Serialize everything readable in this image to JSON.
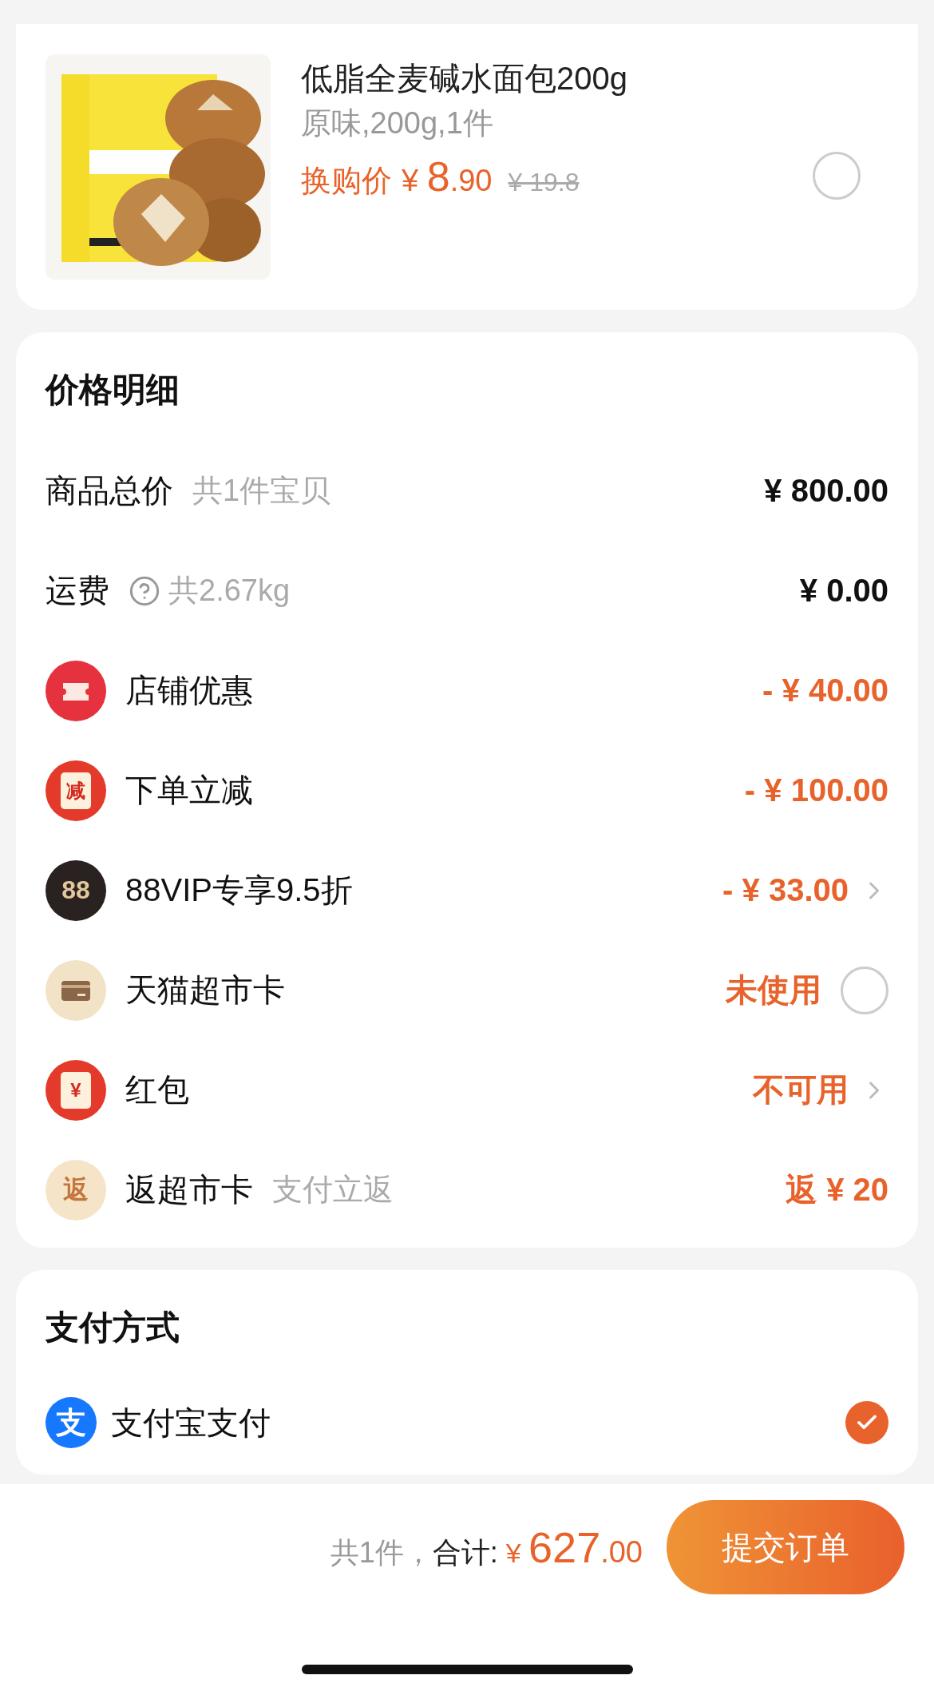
{
  "product": {
    "title": "低脂全麦碱水面包200g",
    "spec": "原味,200g,1件",
    "price_label": "换购价",
    "currency": "¥",
    "price_int": "8",
    "price_dec": ".90",
    "original_price": "¥ 19.8",
    "selected": false
  },
  "price_detail": {
    "title": "价格明细",
    "rows": [
      {
        "kind": "plain",
        "label": "商品总价",
        "note": "共1件宝贝",
        "value": "¥ 800.00"
      },
      {
        "kind": "plain",
        "label": "运费",
        "help": true,
        "note": "共2.67kg",
        "value": "¥ 0.00"
      },
      {
        "kind": "ticket",
        "label": "店铺优惠",
        "value": "- ¥ 40.00"
      },
      {
        "kind": "envelope",
        "glyph": "减",
        "label": "下单立减",
        "value": "- ¥ 100.00"
      },
      {
        "kind": "vip",
        "glyph": "88",
        "label": "88VIP专享9.5折",
        "value": "- ¥ 33.00",
        "expandable": true
      },
      {
        "kind": "card",
        "label": "天猫超市卡",
        "value": "未使用",
        "selected": false
      },
      {
        "kind": "envelope",
        "glyph": "¥",
        "label": "红包",
        "value": "不可用",
        "expandable": true
      },
      {
        "kind": "rebate",
        "glyph": "返",
        "label": "返超市卡",
        "note": "支付立返",
        "value": "返 ¥ 20"
      }
    ]
  },
  "payment": {
    "title": "支付方式",
    "methods": [
      {
        "logo": "支",
        "label": "支付宝支付",
        "selected": true
      }
    ]
  },
  "footer": {
    "count": "共1件，",
    "total_label": "合计:",
    "currency": "¥",
    "total_int": "627",
    "total_dec": ".00",
    "submit": "提交订单"
  }
}
